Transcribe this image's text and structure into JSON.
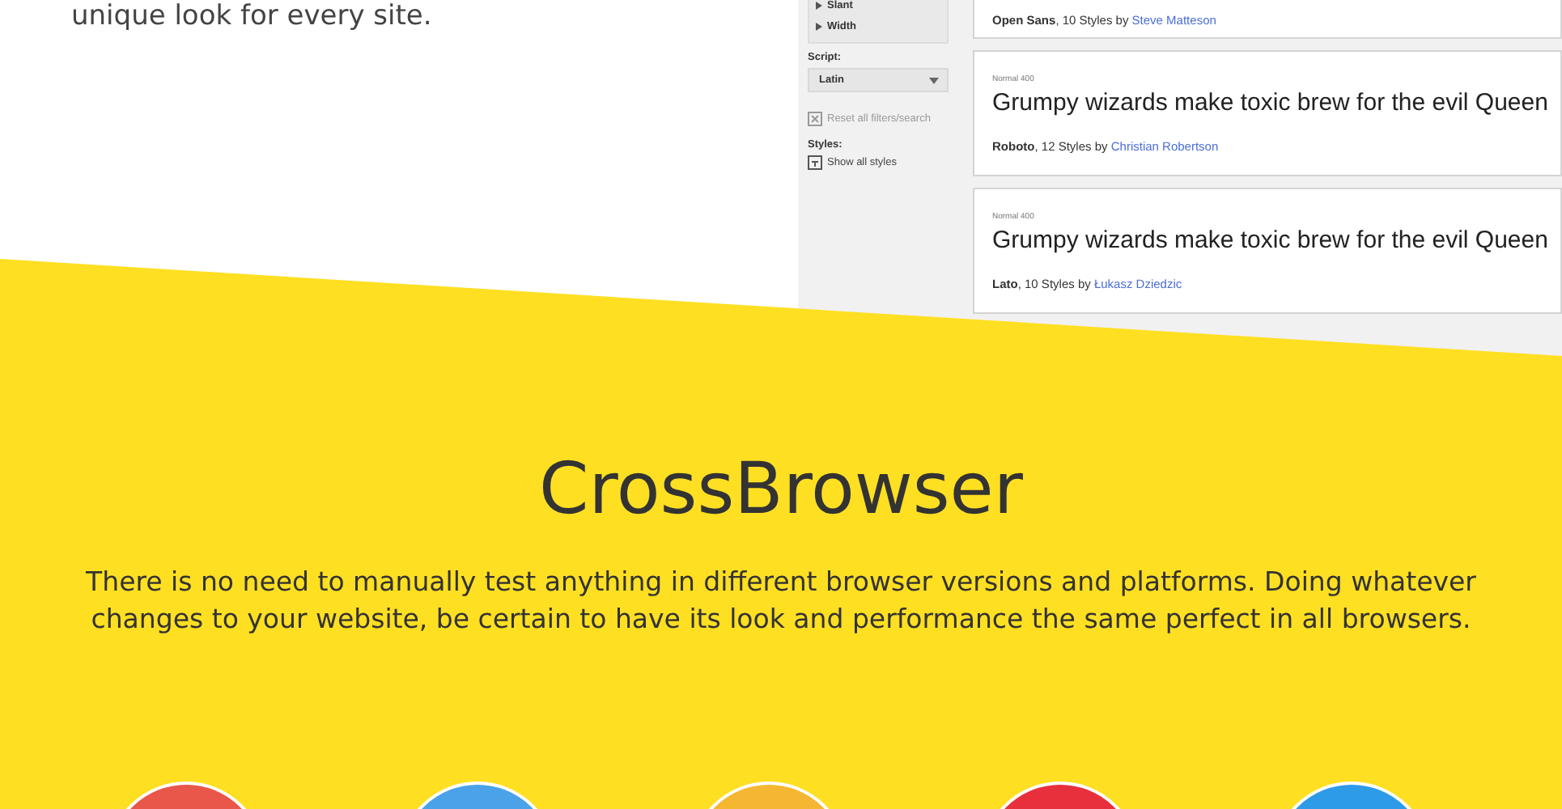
{
  "intro_text": "unique look for every site.",
  "font_browser": {
    "filters": [
      "Slant",
      "Width"
    ],
    "script_label": "Script:",
    "script_value": "Latin",
    "reset_label": "Reset all filters/search",
    "styles_label": "Styles:",
    "show_all_label": "Show all styles",
    "fonts": [
      {
        "name": "Open Sans",
        "styles": ", 10 Styles by ",
        "designer": "Steve Matteson"
      },
      {
        "style_label": "Normal 400",
        "sample": "Grumpy wizards make toxic brew for the evil Queen",
        "name": "Roboto",
        "styles": ", 12 Styles by ",
        "designer": "Christian Robertson"
      },
      {
        "style_label": "Normal 400",
        "sample": "Grumpy wizards make toxic brew for the evil Queen",
        "name": "Lato",
        "styles": ", 10 Styles by ",
        "designer": "Łukasz Dziedzic"
      }
    ]
  },
  "section": {
    "title": "CrossBrowser",
    "description": "There is no need to manually test anything in different browser versions and platforms. Doing whatever changes to your website, be certain to have its look and performance the same perfect in all browsers."
  },
  "browsers": [
    {
      "color": "#e8574a"
    },
    {
      "color": "#4aa3e8"
    },
    {
      "color": "#f5b731"
    },
    {
      "color": "#e8303c"
    },
    {
      "color": "#2d9be8"
    }
  ]
}
